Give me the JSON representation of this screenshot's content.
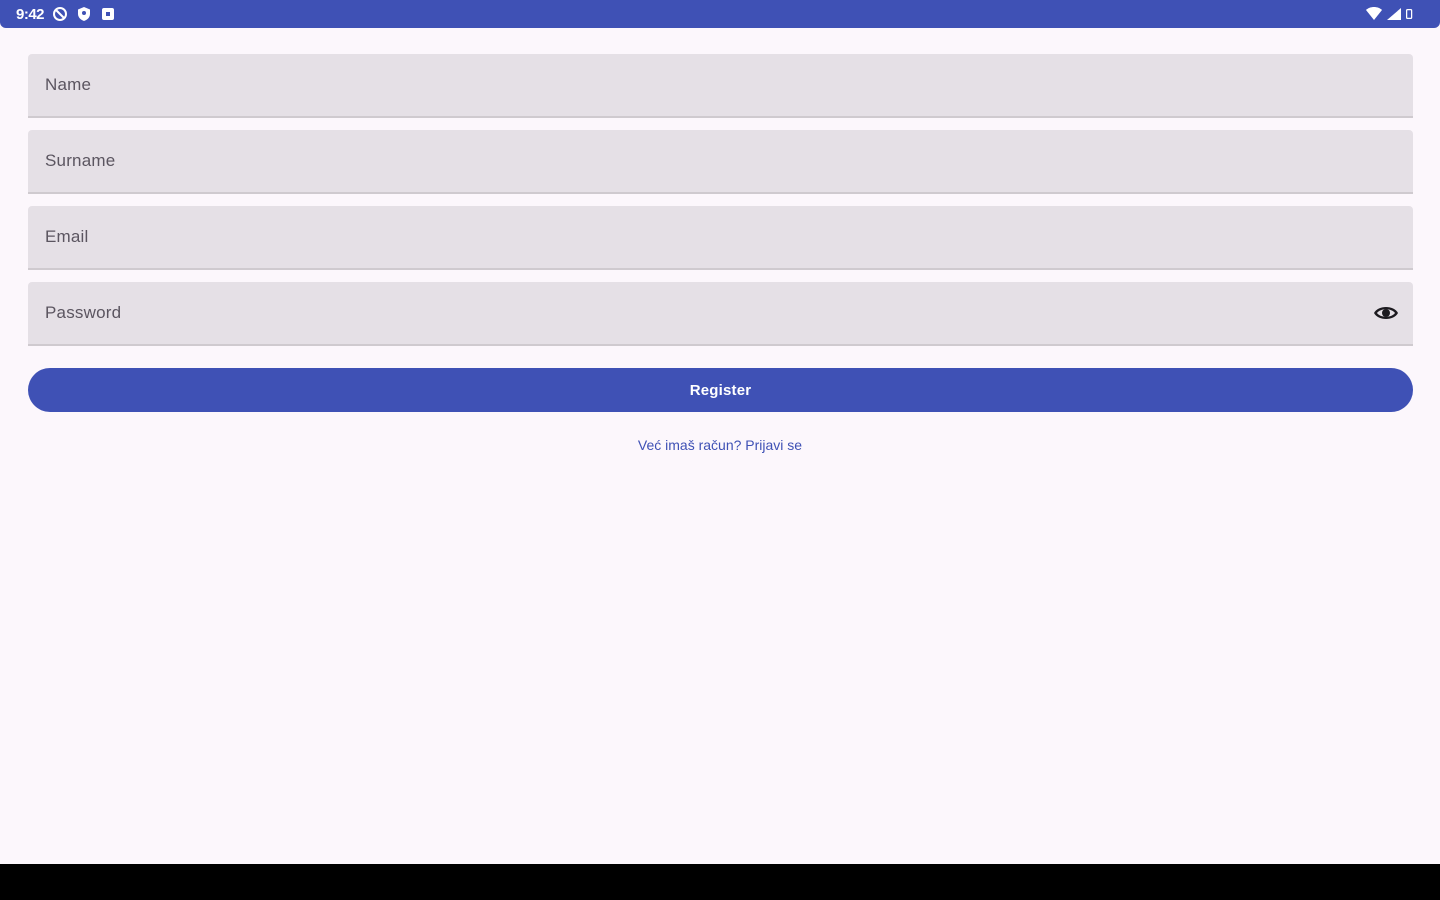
{
  "status_bar": {
    "time": "9:42",
    "left_icons": [
      "do-not-disturb-icon",
      "shield-icon",
      "notification-icon"
    ],
    "right_icons": [
      "wifi-icon",
      "signal-icon",
      "battery-icon"
    ],
    "color": "#3f51b5"
  },
  "form": {
    "name_placeholder": "Name",
    "surname_placeholder": "Surname",
    "email_placeholder": "Email",
    "password_placeholder": "Password",
    "password_toggle_icon": "eye-icon"
  },
  "register_button": {
    "label": "Register",
    "color": "#3f51b5"
  },
  "login_link": {
    "text": "Već imaš račun? Prijavi se"
  },
  "colors": {
    "accent": "#3f51b5",
    "background": "#fcf7fc",
    "field_background": "#e5e0e6",
    "nav_bar": "#000000"
  }
}
